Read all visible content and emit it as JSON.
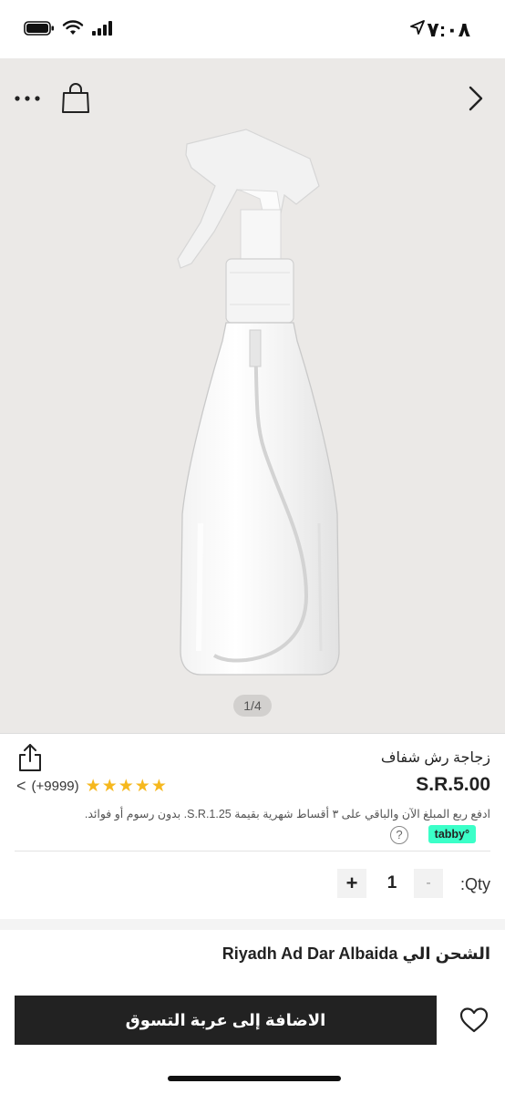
{
  "status_bar": {
    "time": "٧:٠٨",
    "location_icon": "location-arrow-icon",
    "signal_icon": "signal-icon",
    "wifi_icon": "wifi-icon",
    "battery_icon": "battery-icon"
  },
  "hero": {
    "more_icon": "more-dots-icon",
    "bag_icon": "shopping-bag-icon",
    "chevron_icon": "chevron-right-icon",
    "image": "spray-bottle",
    "page_indicator": "1/4"
  },
  "product": {
    "title": "زجاجة رش شفاف",
    "price": "S.R.5.00",
    "rating_stars": 5,
    "rating_count": "(+9999)",
    "rating_chevron": "<",
    "installment_text": "ادفع ربع المبلغ الآن والباقي على ٣ أقساط شهرية بقيمة S.R.1.25. بدون رسوم أو فوائد.",
    "tabby_label": "tabby°",
    "help_label": "?",
    "share_icon": "share-icon"
  },
  "quantity": {
    "label": ":Qty",
    "value": "1",
    "minus": "-",
    "plus": "+"
  },
  "shipping": {
    "label": "الشحن الي",
    "destination": "Riyadh Ad Dar Albaida"
  },
  "bottom_bar": {
    "add_to_cart": "الاضافة إلى عربة التسوق",
    "heart_icon": "heart-icon"
  },
  "colors": {
    "hero_bg": "#ebe9e7",
    "star": "#f6b81e",
    "tabby": "#3bffc8",
    "cta_bg": "#222222"
  }
}
